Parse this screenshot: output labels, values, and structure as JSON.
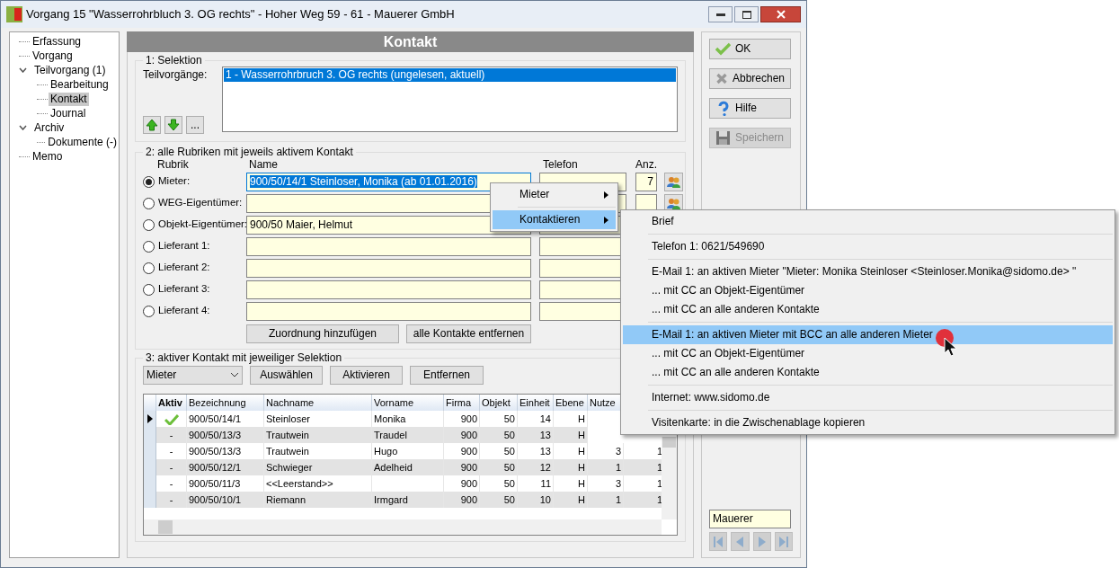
{
  "window": {
    "title": "Vorgang 15 \"Wasserrohrbluch 3. OG rechts\" - Hoher Weg 59 - 61 - Mauerer GmbH"
  },
  "tree": [
    {
      "label": "Erfassung",
      "selected": false
    },
    {
      "label": "Vorgang",
      "selected": false
    },
    {
      "label": "Teilvorgang (1)",
      "selected": false,
      "expanded": true,
      "children": [
        {
          "label": "Bearbeitung",
          "selected": false
        },
        {
          "label": "Kontakt",
          "selected": true
        },
        {
          "label": "Journal",
          "selected": false
        }
      ]
    },
    {
      "label": "Archiv",
      "selected": false,
      "expanded": true,
      "children": [
        {
          "label": "Dokumente (-)",
          "selected": false
        }
      ]
    },
    {
      "label": "Memo",
      "selected": false
    }
  ],
  "header": "Kontakt",
  "selection": {
    "legend": "1: Selektion",
    "label": "Teilvorgänge:",
    "items": [
      {
        "text": "1 - Wasserrohrbruch 3. OG rechts (ungelesen, aktuell)",
        "selected": true
      }
    ],
    "more_button": "..."
  },
  "rubriken": {
    "legend": "2: alle Rubriken mit jeweils aktivem Kontakt",
    "headers": [
      "Rubrik",
      "Name",
      "Telefon",
      "Anz."
    ],
    "rows": [
      {
        "label": "Mieter:",
        "selected": true,
        "name": "900/50/14/1  Steinloser, Monika  (ab 01.01.2016)",
        "count": "7",
        "focused": true,
        "contacts_button": true
      },
      {
        "label": "WEG-Eigentümer:",
        "selected": false,
        "contacts_button": true
      },
      {
        "label": "Objekt-Eigentümer:",
        "selected": false,
        "name": "900/50  Maier, Helmut"
      },
      {
        "label": "Lieferant 1:",
        "selected": false
      },
      {
        "label": "Lieferant 2:",
        "selected": false
      },
      {
        "label": "Lieferant 3:",
        "selected": false
      },
      {
        "label": "Lieferant 4:",
        "selected": false
      }
    ],
    "buttons": [
      "Zuordnung hinzufügen",
      "alle Kontakte entfernen"
    ]
  },
  "aktiv": {
    "legend": "3: aktiver Kontakt mit jeweiliger Selektion",
    "dropdown": "Mieter",
    "buttons": [
      "Auswählen",
      "Aktivieren",
      "Entfernen"
    ],
    "columns": [
      "Aktiv",
      "Bezeichnung",
      "Nachname",
      "Vorname",
      "Firma",
      "Objekt",
      "Einheit",
      "Ebene",
      "Nutze"
    ],
    "rows": [
      {
        "current": true,
        "active": true,
        "cells": [
          "",
          "900/50/14/1",
          "Steinloser",
          "Monika",
          "900",
          "50",
          "14",
          "H"
        ]
      },
      {
        "current": false,
        "active": false,
        "cells": [
          "-",
          "900/50/13/3",
          "Trautwein",
          "Traudel",
          "900",
          "50",
          "13",
          "H"
        ]
      },
      {
        "current": false,
        "active": false,
        "cells": [
          "-",
          "900/50/13/3",
          "Trautwein",
          "Hugo",
          "900",
          "50",
          "13",
          "H",
          "3",
          "1"
        ]
      },
      {
        "current": false,
        "active": false,
        "cells": [
          "-",
          "900/50/12/1",
          "Schwieger",
          "Adelheid",
          "900",
          "50",
          "12",
          "H",
          "1",
          "1"
        ]
      },
      {
        "current": false,
        "active": false,
        "cells": [
          "-",
          "900/50/11/3",
          "<<Leerstand>>",
          "",
          "900",
          "50",
          "11",
          "H",
          "3",
          "1"
        ]
      },
      {
        "current": false,
        "active": false,
        "cells": [
          "-",
          "900/50/10/1",
          "Riemann",
          "Irmgard",
          "900",
          "50",
          "10",
          "H",
          "1",
          "1"
        ]
      }
    ]
  },
  "side_buttons": [
    {
      "label": "OK",
      "kind": "ok",
      "disabled": false
    },
    {
      "label": "Abbrechen",
      "kind": "cancel",
      "disabled": false
    },
    {
      "label": "Hilfe",
      "kind": "help",
      "disabled": false
    },
    {
      "label": "Speichern",
      "kind": "save",
      "disabled": true
    }
  ],
  "owner_field": "Mauerer",
  "context_menu": [
    {
      "label": "Mieter",
      "selected": false
    },
    {
      "label": "Kontaktieren",
      "selected": true
    }
  ],
  "submenu": [
    [
      {
        "label": "Brief",
        "selected": false
      }
    ],
    [
      {
        "label": "Telefon 1: 0621/549690",
        "selected": false
      }
    ],
    [
      {
        "label": "E-Mail 1: an aktiven Mieter \"Mieter: Monika Steinloser <Steinloser.Monika@sidomo.de> \"",
        "selected": false
      },
      {
        "label": "... mit CC an Objekt-Eigentümer",
        "selected": false
      },
      {
        "label": "... mit CC an alle anderen Kontakte",
        "selected": false
      }
    ],
    [
      {
        "label": "E-Mail 1: an aktiven Mieter mit BCC an alle anderen Mieter",
        "selected": true
      },
      {
        "label": "... mit CC an Objekt-Eigentümer",
        "selected": false
      },
      {
        "label": "... mit CC an alle anderen Kontakte",
        "selected": false
      }
    ],
    [
      {
        "label": "Internet: www.sidomo.de",
        "selected": false
      }
    ],
    [
      {
        "label": "Visitenkarte: in die Zwischenablage kopieren",
        "selected": false
      }
    ]
  ]
}
